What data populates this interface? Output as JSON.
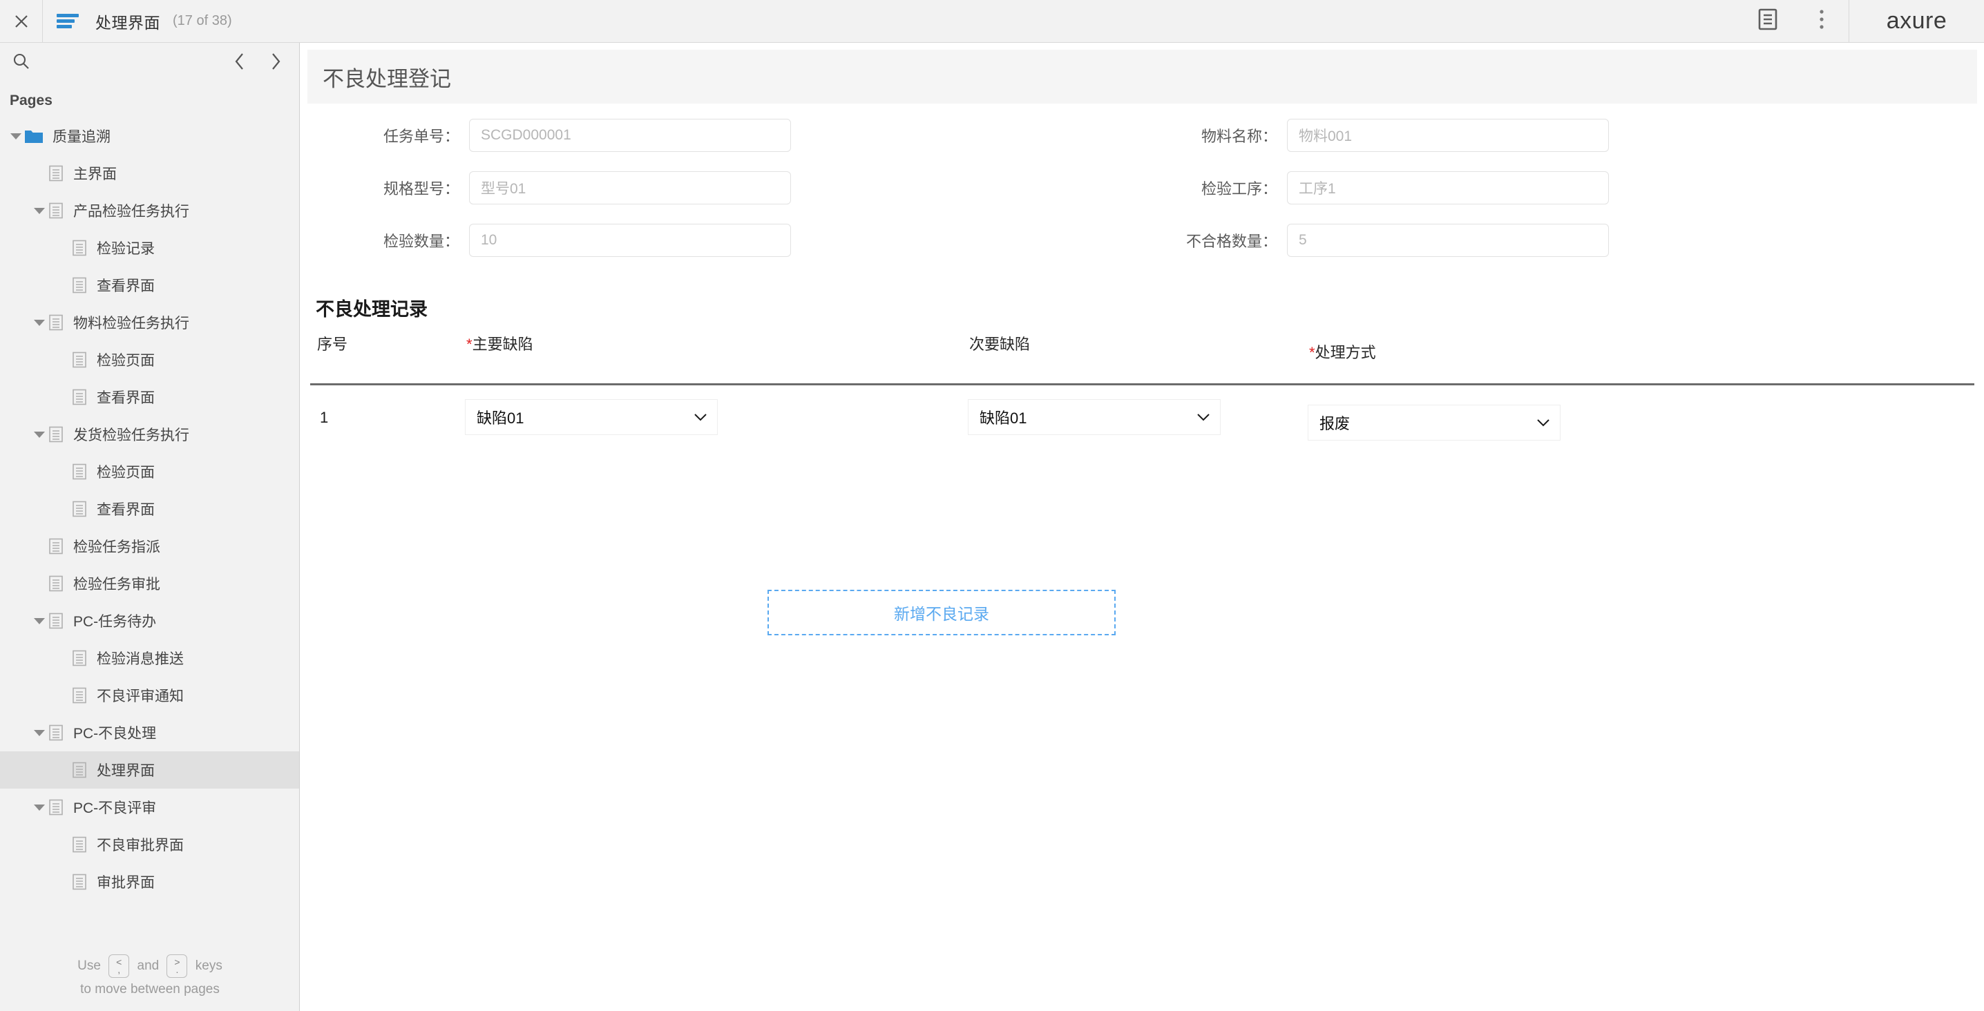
{
  "topbar": {
    "close_icon": "close-icon",
    "menu_icon": "hamburger-menu-icon",
    "title": "处理界面",
    "counter": "(17 of 38)",
    "notes_icon": "page-notes-icon",
    "more_icon": "more-options-icon",
    "brand": "axure"
  },
  "sidebar": {
    "search_icon": "search-icon",
    "prev_icon": "chevron-left-icon",
    "next_icon": "chevron-right-icon",
    "pages_label": "Pages",
    "tree": [
      {
        "label": "质量追溯",
        "indent": 0,
        "icon": "folder",
        "twisty": "open",
        "selected": false
      },
      {
        "label": "主界面",
        "indent": 1,
        "icon": "page",
        "twisty": "none",
        "selected": false
      },
      {
        "label": "产品检验任务执行",
        "indent": 1,
        "icon": "page",
        "twisty": "open",
        "selected": false
      },
      {
        "label": "检验记录",
        "indent": 2,
        "icon": "page",
        "twisty": "none",
        "selected": false
      },
      {
        "label": "查看界面",
        "indent": 2,
        "icon": "page",
        "twisty": "none",
        "selected": false
      },
      {
        "label": "物料检验任务执行",
        "indent": 1,
        "icon": "page",
        "twisty": "open",
        "selected": false
      },
      {
        "label": "检验页面",
        "indent": 2,
        "icon": "page",
        "twisty": "none",
        "selected": false
      },
      {
        "label": "查看界面",
        "indent": 2,
        "icon": "page",
        "twisty": "none",
        "selected": false
      },
      {
        "label": "发货检验任务执行",
        "indent": 1,
        "icon": "page",
        "twisty": "open",
        "selected": false
      },
      {
        "label": "检验页面",
        "indent": 2,
        "icon": "page",
        "twisty": "none",
        "selected": false
      },
      {
        "label": "查看界面",
        "indent": 2,
        "icon": "page",
        "twisty": "none",
        "selected": false
      },
      {
        "label": "检验任务指派",
        "indent": 1,
        "icon": "page",
        "twisty": "none",
        "selected": false
      },
      {
        "label": "检验任务审批",
        "indent": 1,
        "icon": "page",
        "twisty": "none",
        "selected": false
      },
      {
        "label": "PC-任务待办",
        "indent": 1,
        "icon": "page",
        "twisty": "open",
        "selected": false
      },
      {
        "label": "检验消息推送",
        "indent": 2,
        "icon": "page",
        "twisty": "none",
        "selected": false
      },
      {
        "label": "不良评审通知",
        "indent": 2,
        "icon": "page",
        "twisty": "none",
        "selected": false
      },
      {
        "label": "PC-不良处理",
        "indent": 1,
        "icon": "page",
        "twisty": "open",
        "selected": false
      },
      {
        "label": "处理界面",
        "indent": 2,
        "icon": "page",
        "twisty": "none",
        "selected": true
      },
      {
        "label": "PC-不良评审",
        "indent": 1,
        "icon": "page",
        "twisty": "open",
        "selected": false
      },
      {
        "label": "不良审批界面",
        "indent": 2,
        "icon": "page",
        "twisty": "none",
        "selected": false
      },
      {
        "label": "审批界面",
        "indent": 2,
        "icon": "page",
        "twisty": "none",
        "selected": false
      }
    ],
    "hint": {
      "use": "Use",
      "key_prev_top": "<",
      "key_prev_bottom": ",",
      "and": "and",
      "key_next_top": ">",
      "key_next_bottom": ".",
      "keys": "keys",
      "line2": "to move between pages"
    }
  },
  "main": {
    "page_title": "不良处理登记",
    "form": {
      "rows": [
        {
          "left": {
            "label": "任务单号：",
            "placeholder": "SCGD000001"
          },
          "right": {
            "label": "物料名称：",
            "placeholder": "物料001"
          }
        },
        {
          "left": {
            "label": "规格型号：",
            "placeholder": "型号01"
          },
          "right": {
            "label": "检验工序：",
            "placeholder": "工序1"
          }
        },
        {
          "left": {
            "label": "检验数量：",
            "placeholder": "10"
          },
          "right": {
            "label": "不合格数量：",
            "placeholder": "5"
          }
        }
      ]
    },
    "records": {
      "heading": "不良处理记录",
      "columns": [
        {
          "label": "序号",
          "required": false
        },
        {
          "label": "主要缺陷",
          "required": true
        },
        {
          "label": "次要缺陷",
          "required": false
        },
        {
          "label": "处理方式",
          "required": true
        }
      ],
      "rows": [
        {
          "index": "1",
          "major_defect": "缺陷01",
          "minor_defect": "缺陷01",
          "disposition": "报废"
        }
      ],
      "add_button": "新增不良记录"
    }
  },
  "colors": {
    "accent_blue": "#2e8bd0",
    "link_blue": "#5aa9f0",
    "required_red": "#e02020",
    "chrome_gray": "#f2f2f2",
    "selected_row": "#e0e0e0",
    "rule_gray": "#6b6b6b"
  }
}
